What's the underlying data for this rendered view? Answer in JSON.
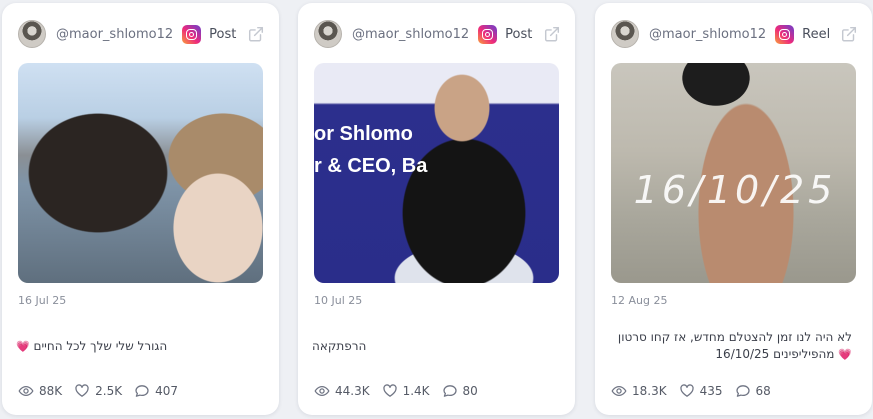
{
  "cards": [
    {
      "handle": "@maor_shlomo12",
      "platform_icon": "instagram-icon",
      "type": "Post",
      "date": "16 Jul 25",
      "caption": "הגורל שלי שלך לכל החיים",
      "caption_emoji": "💗",
      "views": "88K",
      "likes": "2.5K",
      "comments": "407"
    },
    {
      "handle": "@maor_shlomo12",
      "platform_icon": "instagram-icon",
      "type": "Post",
      "date": "10 Jul 25",
      "caption": "הרפתקאה",
      "caption_emoji": "",
      "banner_line1": "or Shlomo",
      "banner_line2": "r & CEO, Ba",
      "views": "44.3K",
      "likes": "1.4K",
      "comments": "80"
    },
    {
      "handle": "@maor_shlomo12",
      "platform_icon": "instagram-icon",
      "type": "Reel",
      "date": "12 Aug 25",
      "caption_line1": "לא היה לנו זמן להצטלם מחדש, אז קחו סרטון",
      "caption_line2": "מהפיליפינים",
      "caption_line2_date": "16/10/25",
      "caption_emoji": "💗",
      "overlay_text": "16/10/25",
      "views": "18.3K",
      "likes": "435",
      "comments": "68"
    }
  ],
  "colors": {
    "background": "#eef0f4",
    "card": "#ffffff",
    "heart": "#e8459a"
  }
}
